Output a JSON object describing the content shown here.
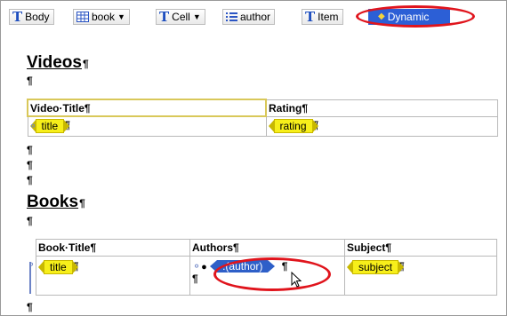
{
  "breadcrumbs": [
    {
      "label": "Body",
      "icon": "text-t-icon",
      "dropdown": false
    },
    {
      "label": "book",
      "icon": "table-icon",
      "dropdown": true
    },
    {
      "label": "Cell",
      "icon": "text-t-icon",
      "dropdown": true
    },
    {
      "label": "author",
      "icon": "list-icon",
      "dropdown": false
    },
    {
      "label": "Item",
      "icon": "text-t-icon",
      "dropdown": false
    },
    {
      "label": "Dynamic",
      "icon": "dynamic-diamond-icon",
      "dropdown": false
    }
  ],
  "pilcrow": "¶",
  "videos": {
    "heading": "Videos",
    "columns": [
      "Video·Title¶",
      "Rating¶"
    ],
    "row": {
      "title_tag": "title",
      "rating_tag": "rating"
    }
  },
  "books": {
    "heading": "Books",
    "columns": [
      "Book·Title¶",
      "Authors¶",
      "Subject¶"
    ],
    "row": {
      "title_tag": "title",
      "author_tag": ".(author)",
      "subject_tag": "subject"
    }
  },
  "colors": {
    "accent": "#2c5fd6",
    "highlight_ellipse": "#e0141c",
    "tag_fill": "#f7ef1a"
  }
}
